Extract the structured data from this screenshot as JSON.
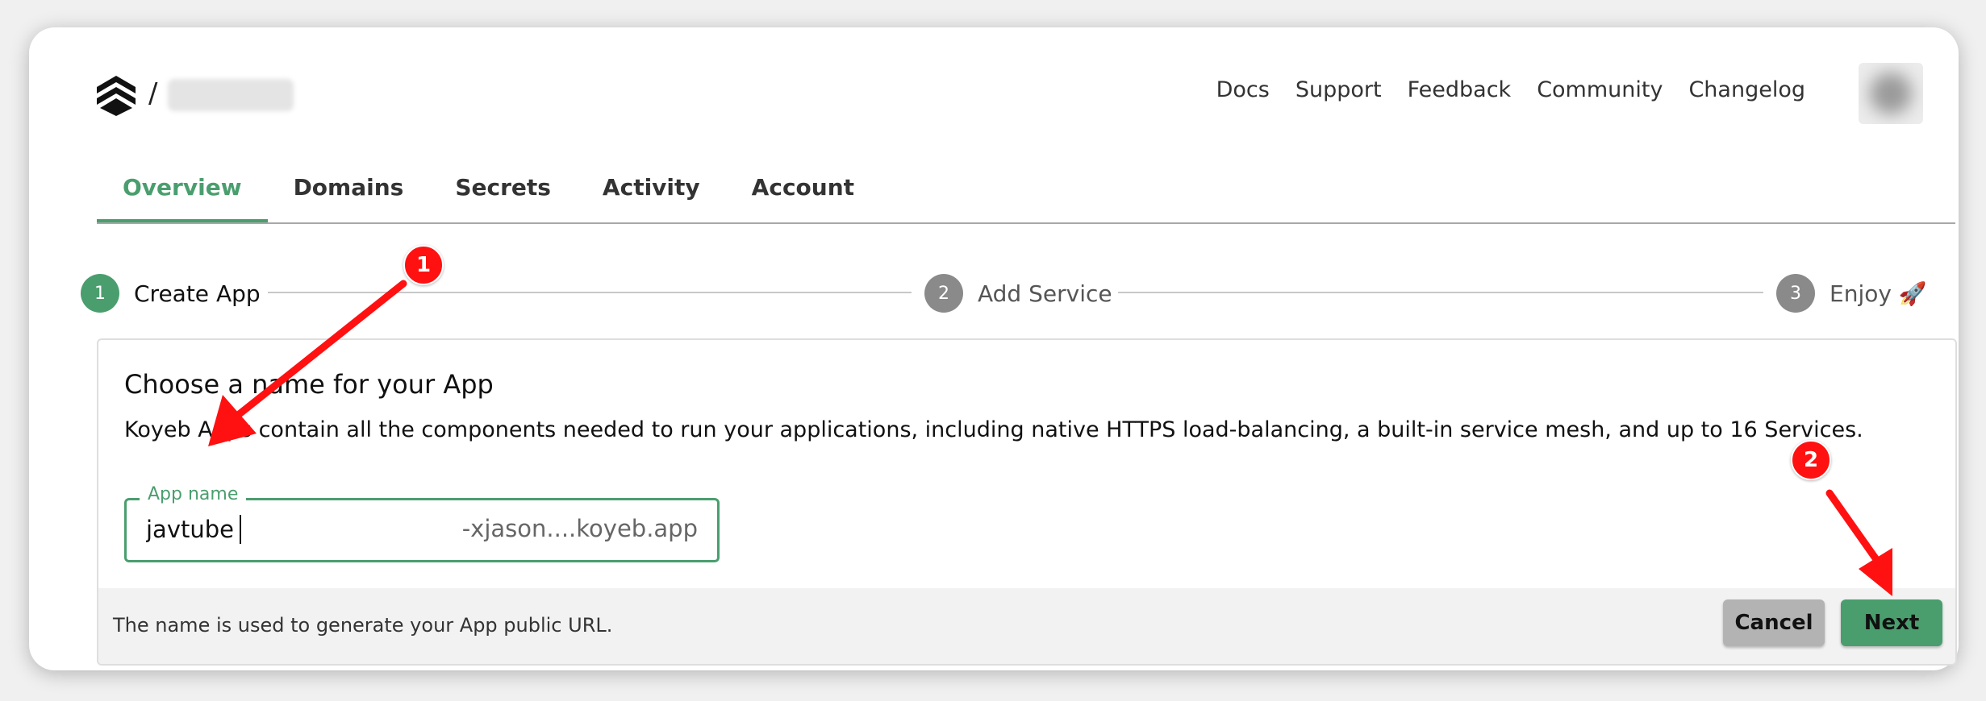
{
  "header": {
    "separator": "/",
    "nav": [
      "Docs",
      "Support",
      "Feedback",
      "Community",
      "Changelog"
    ]
  },
  "tabs": [
    "Overview",
    "Domains",
    "Secrets",
    "Activity",
    "Account"
  ],
  "active_tab": "Overview",
  "stepper": [
    {
      "num": "1",
      "label": "Create App",
      "state": "active"
    },
    {
      "num": "2",
      "label": "Add Service",
      "state": "pending"
    },
    {
      "num": "3",
      "label": "Enjoy 🚀",
      "state": "pending"
    }
  ],
  "card": {
    "title": "Choose a name for your App",
    "description": "Koyeb Apps contain all the components needed to run your applications, including native HTTPS load-balancing, a built-in service mesh, and up to 16 Services.",
    "field_label": "App name",
    "field_value": "javtube",
    "field_suffix": "-xjason....koyeb.app",
    "hint": "The name is used to generate your App public URL.",
    "cancel_label": "Cancel",
    "next_label": "Next"
  },
  "annotations": {
    "badge_1": "1",
    "badge_2": "2",
    "arrow_color": "#ff1111"
  },
  "colors": {
    "accent": "#4a9e6e",
    "step_pending": "#8a8a8a"
  }
}
